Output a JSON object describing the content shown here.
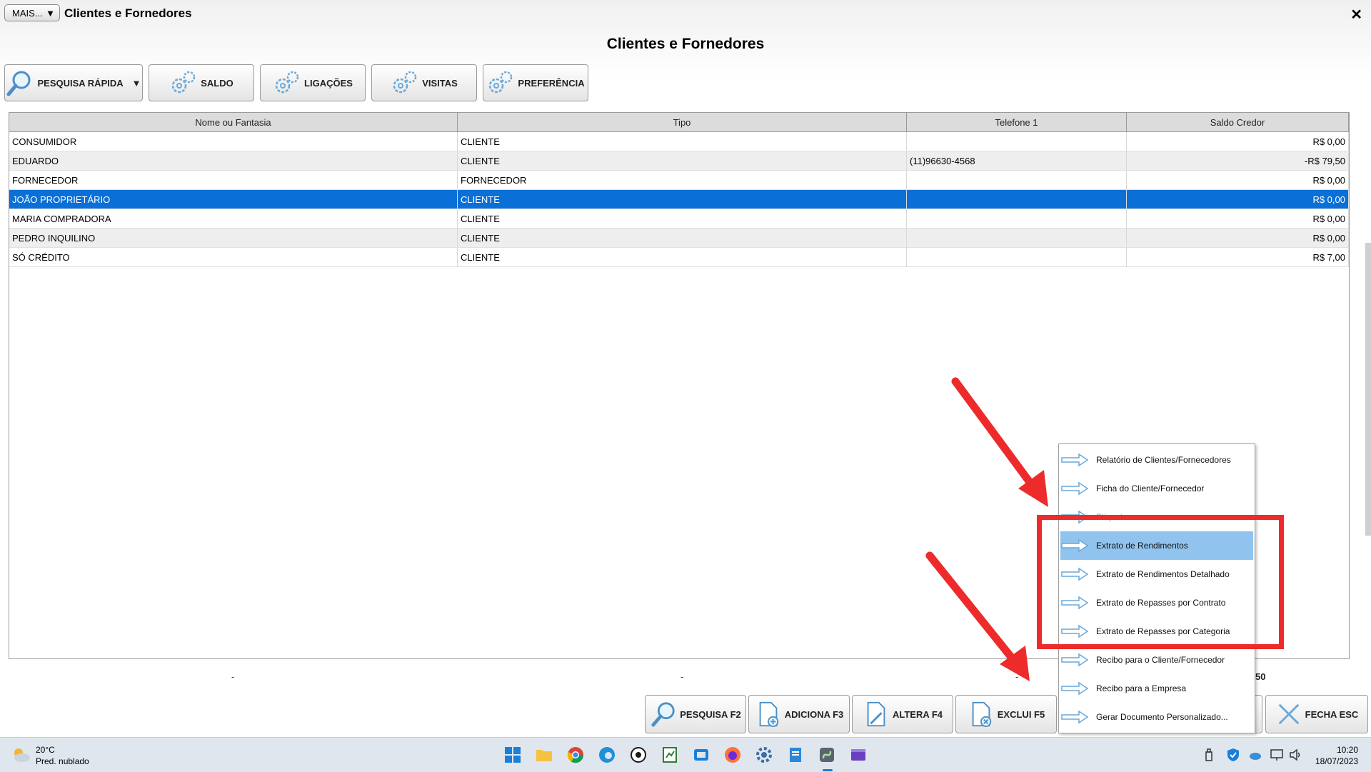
{
  "window": {
    "mais_label": "MAIS...",
    "caret": "▼",
    "title": "Clientes e Fornedores",
    "close_glyph": "✕",
    "page_title": "Clientes e Fornedores"
  },
  "toolbar": {
    "pesquisa_rapida": "PESQUISA RÁPIDA",
    "pesquisa_caret": "▼",
    "saldo": "SALDO",
    "ligacoes": "LIGAÇÕES",
    "visitas": "VISITAS",
    "preferencia": "PREFERÊNCIA"
  },
  "table": {
    "columns": [
      "Nome ou Fantasia",
      "Tipo",
      "Telefone 1",
      "Saldo Credor"
    ],
    "rows": [
      {
        "nome": "CONSUMIDOR",
        "tipo": "CLIENTE",
        "telefone": "",
        "saldo": "R$ 0,00"
      },
      {
        "nome": "EDUARDO",
        "tipo": "CLIENTE",
        "telefone": "(11)96630-4568",
        "saldo": "-R$ 79,50"
      },
      {
        "nome": "FORNECEDOR",
        "tipo": "FORNECEDOR",
        "telefone": "",
        "saldo": "R$ 0,00"
      },
      {
        "nome": "JOÃO PROPRIETÁRIO",
        "tipo": "CLIENTE",
        "telefone": "",
        "saldo": "R$ 0,00"
      },
      {
        "nome": "MARIA COMPRADORA",
        "tipo": "CLIENTE",
        "telefone": "",
        "saldo": "R$ 0,00"
      },
      {
        "nome": "PEDRO INQUILINO",
        "tipo": "CLIENTE",
        "telefone": "",
        "saldo": "R$ 0,00"
      },
      {
        "nome": "SÓ CRÉDITO",
        "tipo": "CLIENTE",
        "telefone": "",
        "saldo": "R$ 7,00"
      }
    ],
    "selected_row": 3
  },
  "footer": {
    "dash": "-",
    "total_fragment": "50"
  },
  "bottom_buttons": {
    "pesquisa": "PESQUISA F2",
    "adiciona": "ADICIONA F3",
    "altera": "ALTERA F4",
    "exclui": "EXCLUI F5",
    "fecha": "FECHA ESC"
  },
  "context_menu": {
    "items": [
      "Relatório de Clientes/Fornecedores",
      "Ficha do Cliente/Fornecedor",
      "Etiquetas",
      "Extrato de Rendimentos",
      "Extrato de Rendimentos Detalhado",
      "Extrato de Repasses por Contrato",
      "Extrato de Repasses por Categoria",
      "Recibo para o Cliente/Fornecedor",
      "Recibo para a Empresa",
      "Gerar Documento Personalizado..."
    ],
    "highlighted_index": 3
  },
  "taskbar": {
    "temperature": "20°C",
    "weather": "Pred. nublado",
    "time": "10:20",
    "date": "18/07/2023"
  },
  "colors": {
    "selection": "#0a6fd6",
    "menu_highlight": "#90c4ee",
    "annotation_red": "#ee2b2b"
  }
}
